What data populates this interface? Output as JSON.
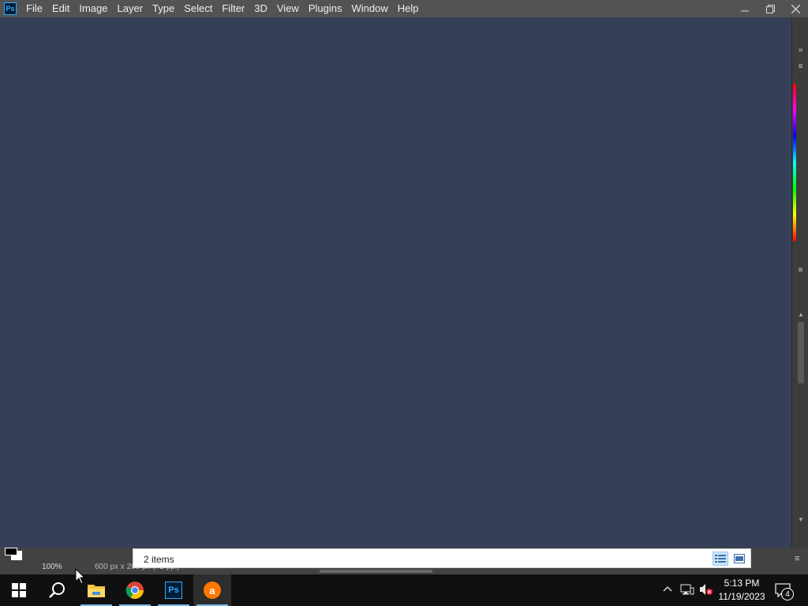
{
  "app": {
    "logo_text": "Ps",
    "menu": [
      "File",
      "Edit",
      "Image",
      "Layer",
      "Type",
      "Select",
      "Filter",
      "3D",
      "View",
      "Plugins",
      "Window",
      "Help"
    ],
    "window_controls": {
      "minimize": "—",
      "restore": "❐",
      "close": "✕"
    }
  },
  "canvas": {
    "background": "#353f57"
  },
  "status": {
    "zoom": "100%",
    "doc_info": "600 px x 200 px (72 ppi)"
  },
  "explorer_popup": {
    "items_count": "2 items"
  },
  "taskbar": {
    "pinned": [
      {
        "name": "start",
        "icon": "windows-icon"
      },
      {
        "name": "search",
        "icon": "search-icon"
      },
      {
        "name": "file-explorer",
        "icon": "folder-icon"
      },
      {
        "name": "chrome",
        "icon": "chrome-icon"
      },
      {
        "name": "photoshop",
        "icon": "photoshop-icon",
        "text": "Ps"
      },
      {
        "name": "avast",
        "icon": "avast-icon",
        "text": "a"
      }
    ],
    "clock_time": "5:13 PM",
    "clock_date": "11/19/2023",
    "notification_count": "4"
  },
  "colors": {
    "menubar": "#535353",
    "accent_ps": "#31a8ff",
    "taskbar": "#101010",
    "avast": "#ff7800"
  }
}
